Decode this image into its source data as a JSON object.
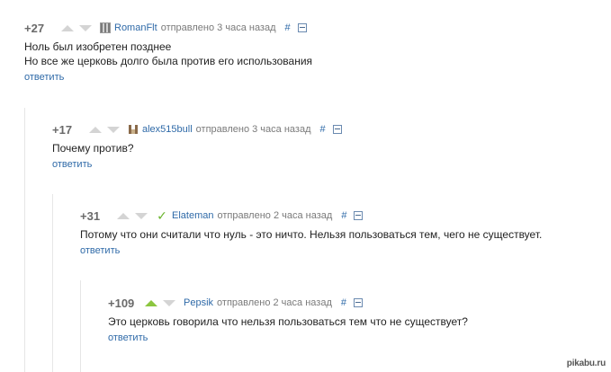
{
  "comments": [
    {
      "rating": "+27",
      "author": "RomanFlt",
      "sent": "отправлено 3 часа назад",
      "hash": "#",
      "lines": [
        "Ноль был изобретен позднее",
        "Но все же церковь долго была против его использования"
      ],
      "reply": "ответить",
      "upvoted": false
    },
    {
      "rating": "+17",
      "author": "alex515bull",
      "sent": "отправлено 3 часа назад",
      "hash": "#",
      "lines": [
        "Почему против?"
      ],
      "reply": "ответить",
      "upvoted": false
    },
    {
      "rating": "+31",
      "author": "Elateman",
      "sent": "отправлено 2 часа назад",
      "hash": "#",
      "lines": [
        "Потому что они считали что нуль - это ничто. Нельзя пользоваться тем, чего не существует."
      ],
      "reply": "ответить",
      "upvoted": false
    },
    {
      "rating": "+109",
      "author": "Pepsik",
      "sent": "отправлено 2 часа назад",
      "hash": "#",
      "lines": [
        "Это церковь говорила что нельзя пользоваться тем что не существует?"
      ],
      "reply": "ответить",
      "upvoted": true
    }
  ],
  "watermark": "pikabu.ru",
  "colors": {
    "link": "#2f6aa8",
    "rating": "#6a6a6a",
    "upvote_active": "#8cc63f",
    "vote_inactive": "#d4d4d4"
  },
  "icons": {
    "upvote": "triangle-up-icon",
    "downvote": "triangle-down-icon",
    "collapse": "minus-box-icon"
  }
}
